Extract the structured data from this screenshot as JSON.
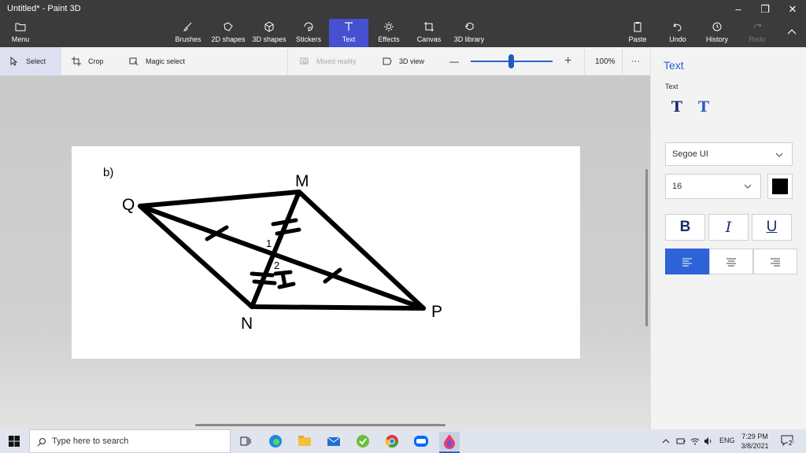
{
  "window": {
    "title": "Untitled* - Paint 3D",
    "controls": {
      "minimize": "–",
      "restore": "❐",
      "close": "✕"
    }
  },
  "ribbon": {
    "menu": "Menu",
    "tools": [
      {
        "label": "Brushes",
        "icon": "brush-icon"
      },
      {
        "label": "2D shapes",
        "icon": "shapes-2d-icon"
      },
      {
        "label": "3D shapes",
        "icon": "cube-icon"
      },
      {
        "label": "Stickers",
        "icon": "sticker-icon"
      },
      {
        "label": "Text",
        "icon": "text-icon",
        "active": true
      },
      {
        "label": "Effects",
        "icon": "sun-icon"
      },
      {
        "label": "Canvas",
        "icon": "canvas-icon"
      },
      {
        "label": "3D library",
        "icon": "library-icon"
      }
    ],
    "paste": "Paste",
    "undo": "Undo",
    "history": "History",
    "redo": "Redo"
  },
  "toolbar": {
    "select": "Select",
    "crop": "Crop",
    "magic_select": "Magic select",
    "mixed_reality": "Mixed reality",
    "view_3d": "3D view",
    "zoom_minus": "—",
    "zoom_plus": "+",
    "zoom_level": "100%",
    "zoom_fraction": 0.5,
    "more": "···"
  },
  "canvas": {
    "part_label": "b)",
    "vertices": {
      "q": "Q",
      "m": "M",
      "n": "N",
      "p": "P"
    },
    "angle_labels": {
      "one": "1",
      "two": "2"
    }
  },
  "panel": {
    "title": "Text",
    "subtitle": "Text",
    "font_family": "Segoe UI",
    "font_size": "16",
    "text_color": "#000000",
    "bold": "B",
    "italic": "I",
    "underline": "U",
    "active_align": "left"
  },
  "taskbar": {
    "search_placeholder": "Type here to search",
    "language": "ENG",
    "time": "7:29 PM",
    "date": "3/8/2021",
    "notification_count": "2"
  },
  "colors": {
    "accent": "#4551d0",
    "ribbon_bg": "#3b3b3b",
    "panel_title": "#2b5fcc"
  }
}
